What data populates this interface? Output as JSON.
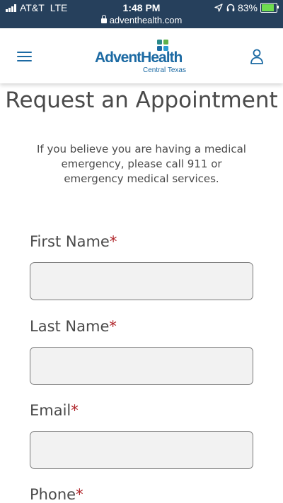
{
  "status_bar": {
    "carrier": "AT&T",
    "network": "LTE",
    "time": "1:48 PM",
    "url": "adventhealth.com",
    "battery": "83%",
    "battery_level": 0.83,
    "icons": [
      "signal-icon",
      "lock-icon",
      "location-icon",
      "headphones-icon",
      "battery-icon"
    ]
  },
  "header": {
    "logo_text": "AdventHealth",
    "logo_subtitle": "Central Texas",
    "icons": [
      "hamburger-menu-icon",
      "user-account-icon"
    ],
    "brand_color": "#1c6aa3"
  },
  "page": {
    "title": "Request an Appointment",
    "notice": "If you believe you are having a medical emergency, please call 911 or emergency medical services."
  },
  "form": {
    "required_mark": "*",
    "required_color": "#b0262b",
    "fields": [
      {
        "label": "First Name",
        "value": "",
        "placeholder": ""
      },
      {
        "label": "Last Name",
        "value": "",
        "placeholder": ""
      },
      {
        "label": "Email",
        "value": "",
        "placeholder": ""
      },
      {
        "label": "Phone"
      }
    ]
  }
}
